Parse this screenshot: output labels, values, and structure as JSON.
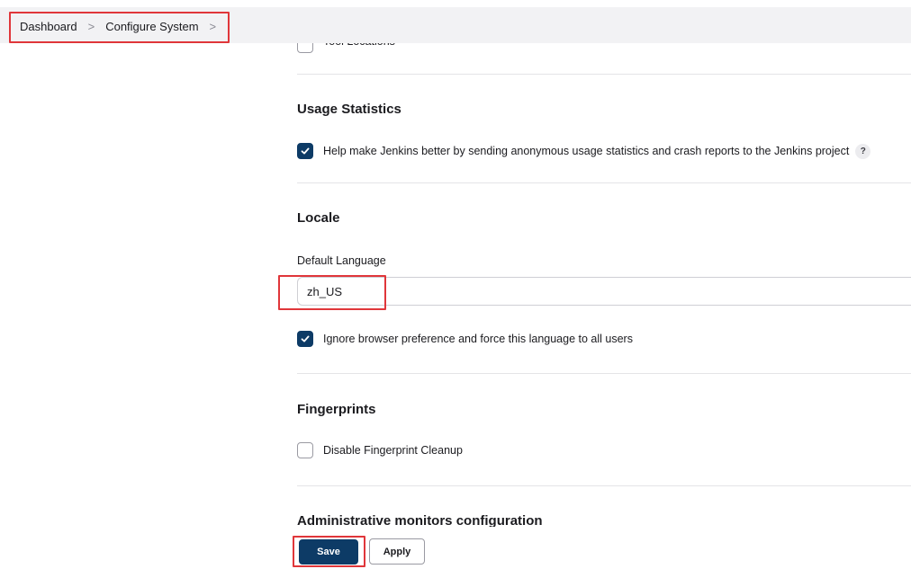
{
  "breadcrumb": {
    "items": [
      {
        "label": "Dashboard"
      },
      {
        "label": "Configure System"
      }
    ],
    "separator": ">"
  },
  "tool_locations": {
    "label": "Tool Locations",
    "checked": false
  },
  "usage_statistics": {
    "title": "Usage Statistics",
    "checkbox_label": "Help make Jenkins better by sending anonymous usage statistics and crash reports to the Jenkins project",
    "checked": true,
    "help": "?"
  },
  "locale": {
    "title": "Locale",
    "field_label": "Default Language",
    "value": "zh_US",
    "ignore_label": "Ignore browser preference and force this language to all users",
    "ignore_checked": true
  },
  "fingerprints": {
    "title": "Fingerprints",
    "checkbox_label": "Disable Fingerprint Cleanup",
    "checked": false
  },
  "admin_monitors": {
    "title": "Administrative monitors configuration"
  },
  "buttons": {
    "save": "Save",
    "apply": "Apply"
  },
  "colors": {
    "primary": "#0d3b66",
    "highlight": "#e0363a",
    "breadcrumb_bg": "#f2f2f4"
  }
}
